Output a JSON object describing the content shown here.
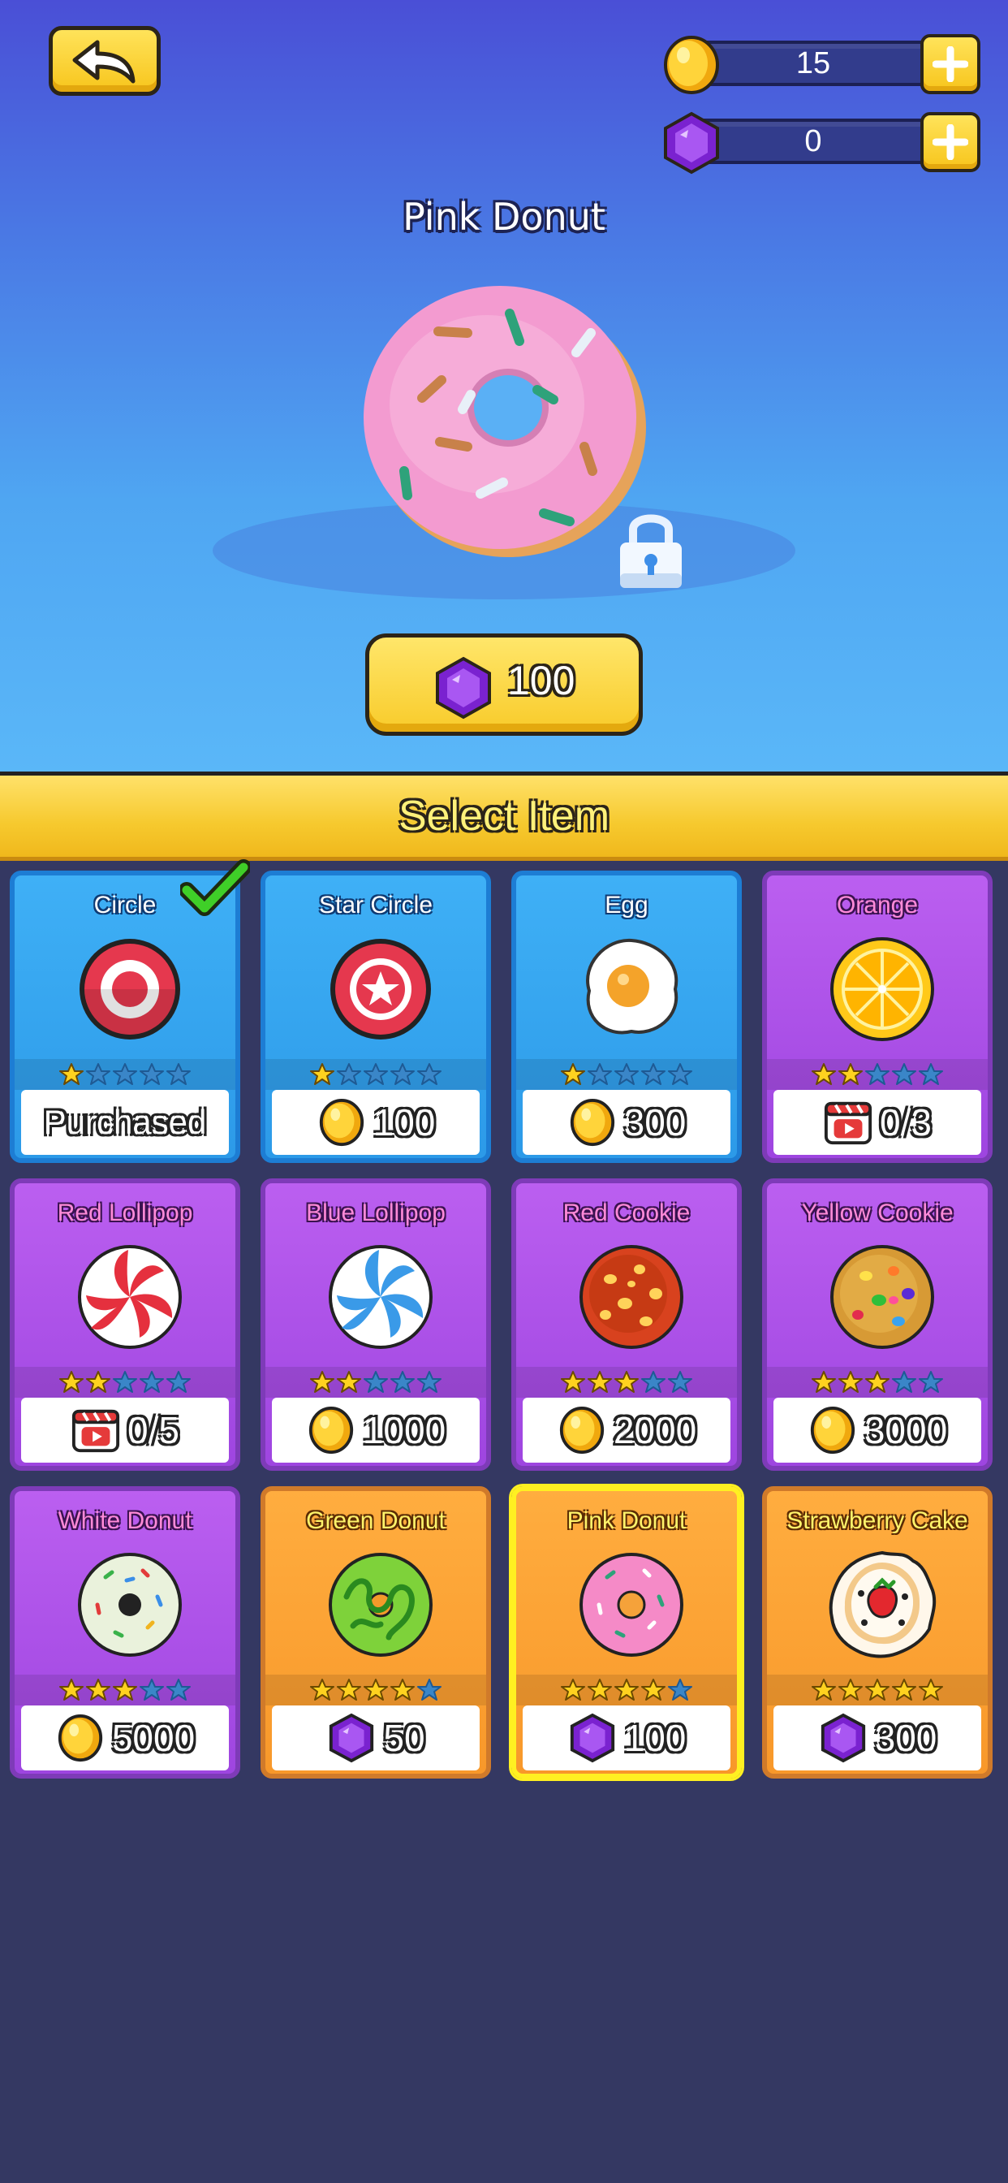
{
  "header": {
    "back_icon": "back-arrow-icon",
    "coins": "15",
    "gems": "0"
  },
  "preview": {
    "title": "Pink Donut",
    "price": "100",
    "price_currency": "gem",
    "locked": true
  },
  "section_title": "Select Item",
  "items": [
    {
      "name": "Circle",
      "stars": 1,
      "price": "Purchased",
      "currency": "none",
      "theme": "blue",
      "icon": "target-icon",
      "checked": true
    },
    {
      "name": "Star Circle",
      "stars": 1,
      "price": "100",
      "currency": "coin",
      "theme": "blue",
      "icon": "star-circle-icon"
    },
    {
      "name": "Egg",
      "stars": 1,
      "price": "300",
      "currency": "coin",
      "theme": "blue",
      "icon": "egg-icon"
    },
    {
      "name": "Orange",
      "stars": 2,
      "price": "0/3",
      "currency": "video",
      "theme": "purple",
      "icon": "orange-slice-icon"
    },
    {
      "name": "Red Lollipop",
      "stars": 2,
      "price": "0/5",
      "currency": "video",
      "theme": "purple",
      "icon": "red-lollipop-icon"
    },
    {
      "name": "Blue Lollipop",
      "stars": 2,
      "price": "1000",
      "currency": "coin",
      "theme": "purple",
      "icon": "blue-lollipop-icon"
    },
    {
      "name": "Red Cookie",
      "stars": 3,
      "price": "2000",
      "currency": "coin",
      "theme": "purple",
      "icon": "red-cookie-icon"
    },
    {
      "name": "Yellow Cookie",
      "stars": 3,
      "price": "3000",
      "currency": "coin",
      "theme": "purple",
      "icon": "yellow-cookie-icon"
    },
    {
      "name": "White Donut",
      "stars": 3,
      "price": "5000",
      "currency": "coin",
      "theme": "purple",
      "icon": "white-donut-icon"
    },
    {
      "name": "Green Donut",
      "stars": 4,
      "price": "50",
      "currency": "gem",
      "theme": "orange",
      "icon": "green-donut-icon"
    },
    {
      "name": "Pink Donut",
      "stars": 4,
      "price": "100",
      "currency": "gem",
      "theme": "orange",
      "icon": "pink-donut-icon",
      "selected": true
    },
    {
      "name": "Strawberry Cake",
      "stars": 5,
      "price": "300",
      "currency": "gem",
      "theme": "orange",
      "icon": "strawberry-cake-icon"
    }
  ],
  "colors": {
    "coin": "#f6c61e",
    "gem": "#8a2fe0",
    "star_on": "#ffd21f",
    "star_off": "#3a86c8"
  }
}
